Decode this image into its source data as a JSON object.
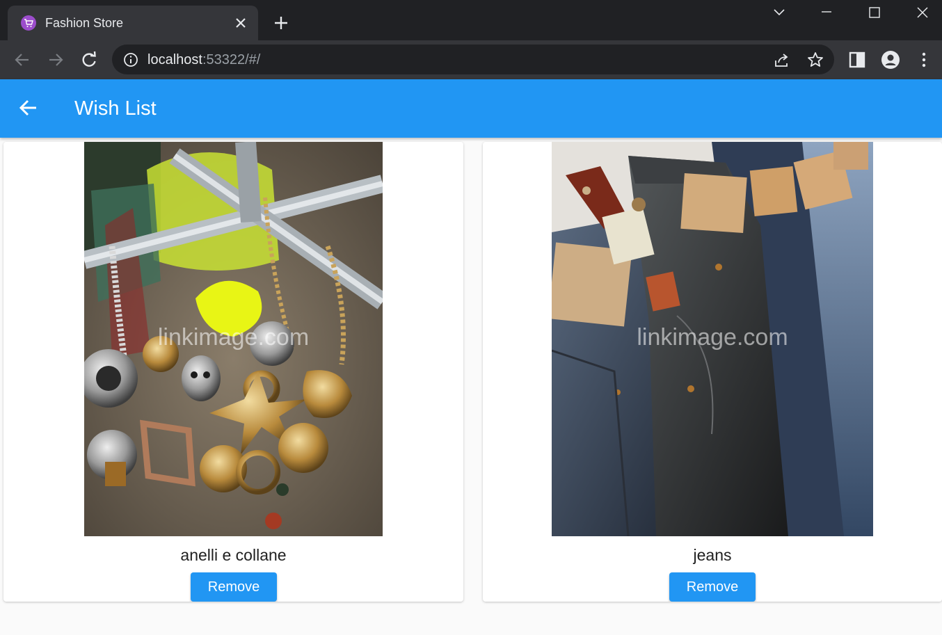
{
  "browser": {
    "tab_title": "Fashion Store",
    "url_host": "localhost",
    "url_rest": ":53322/#/"
  },
  "app": {
    "title": "Wish List",
    "theme_color": "#2196f3"
  },
  "wishlist": {
    "items": [
      {
        "name": "anelli e collane",
        "image_icon": "jewelry-photo",
        "watermark": "linkimage.com",
        "remove_label": "Remove"
      },
      {
        "name": "jeans",
        "image_icon": "jeans-photo",
        "watermark": "linkimage.com",
        "remove_label": "Remove"
      }
    ]
  }
}
